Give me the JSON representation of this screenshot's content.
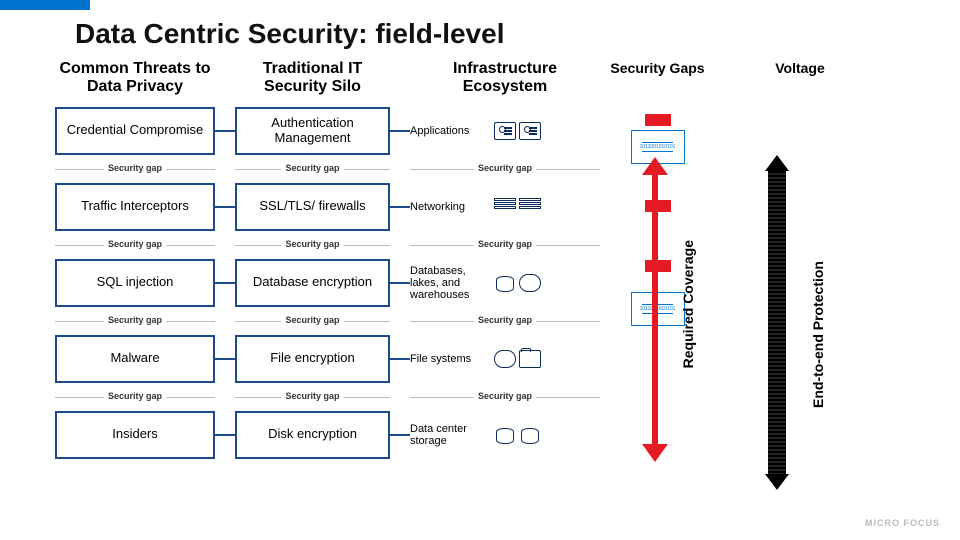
{
  "title": "Data Centric Security: field-level",
  "headers": {
    "threats": "Common Threats to Data Privacy",
    "silo": "Traditional IT Security Silo",
    "infra": "Infrastructure Ecosystem",
    "gaps": "Security Gaps",
    "voltage": "Voltage"
  },
  "rows": [
    {
      "threat": "Credential Compromise",
      "silo": "Authentication Management",
      "infra": "Applications"
    },
    {
      "threat": "Traffic Interceptors",
      "silo": "SSL/TLS/ firewalls",
      "infra": "Networking"
    },
    {
      "threat": "SQL injection",
      "silo": "Database encryption",
      "infra": "Databases, lakes, and warehouses"
    },
    {
      "threat": "Malware",
      "silo": "File encryption",
      "infra": "File systems"
    },
    {
      "threat": "Insiders",
      "silo": "Disk encryption",
      "infra": "Data center storage"
    }
  ],
  "gap_label": "Security gap",
  "emblem_text": "1011001010101",
  "required_coverage": "Required Coverage",
  "e2e": "End-to-end Protection",
  "footer": "MICRO FOCUS"
}
